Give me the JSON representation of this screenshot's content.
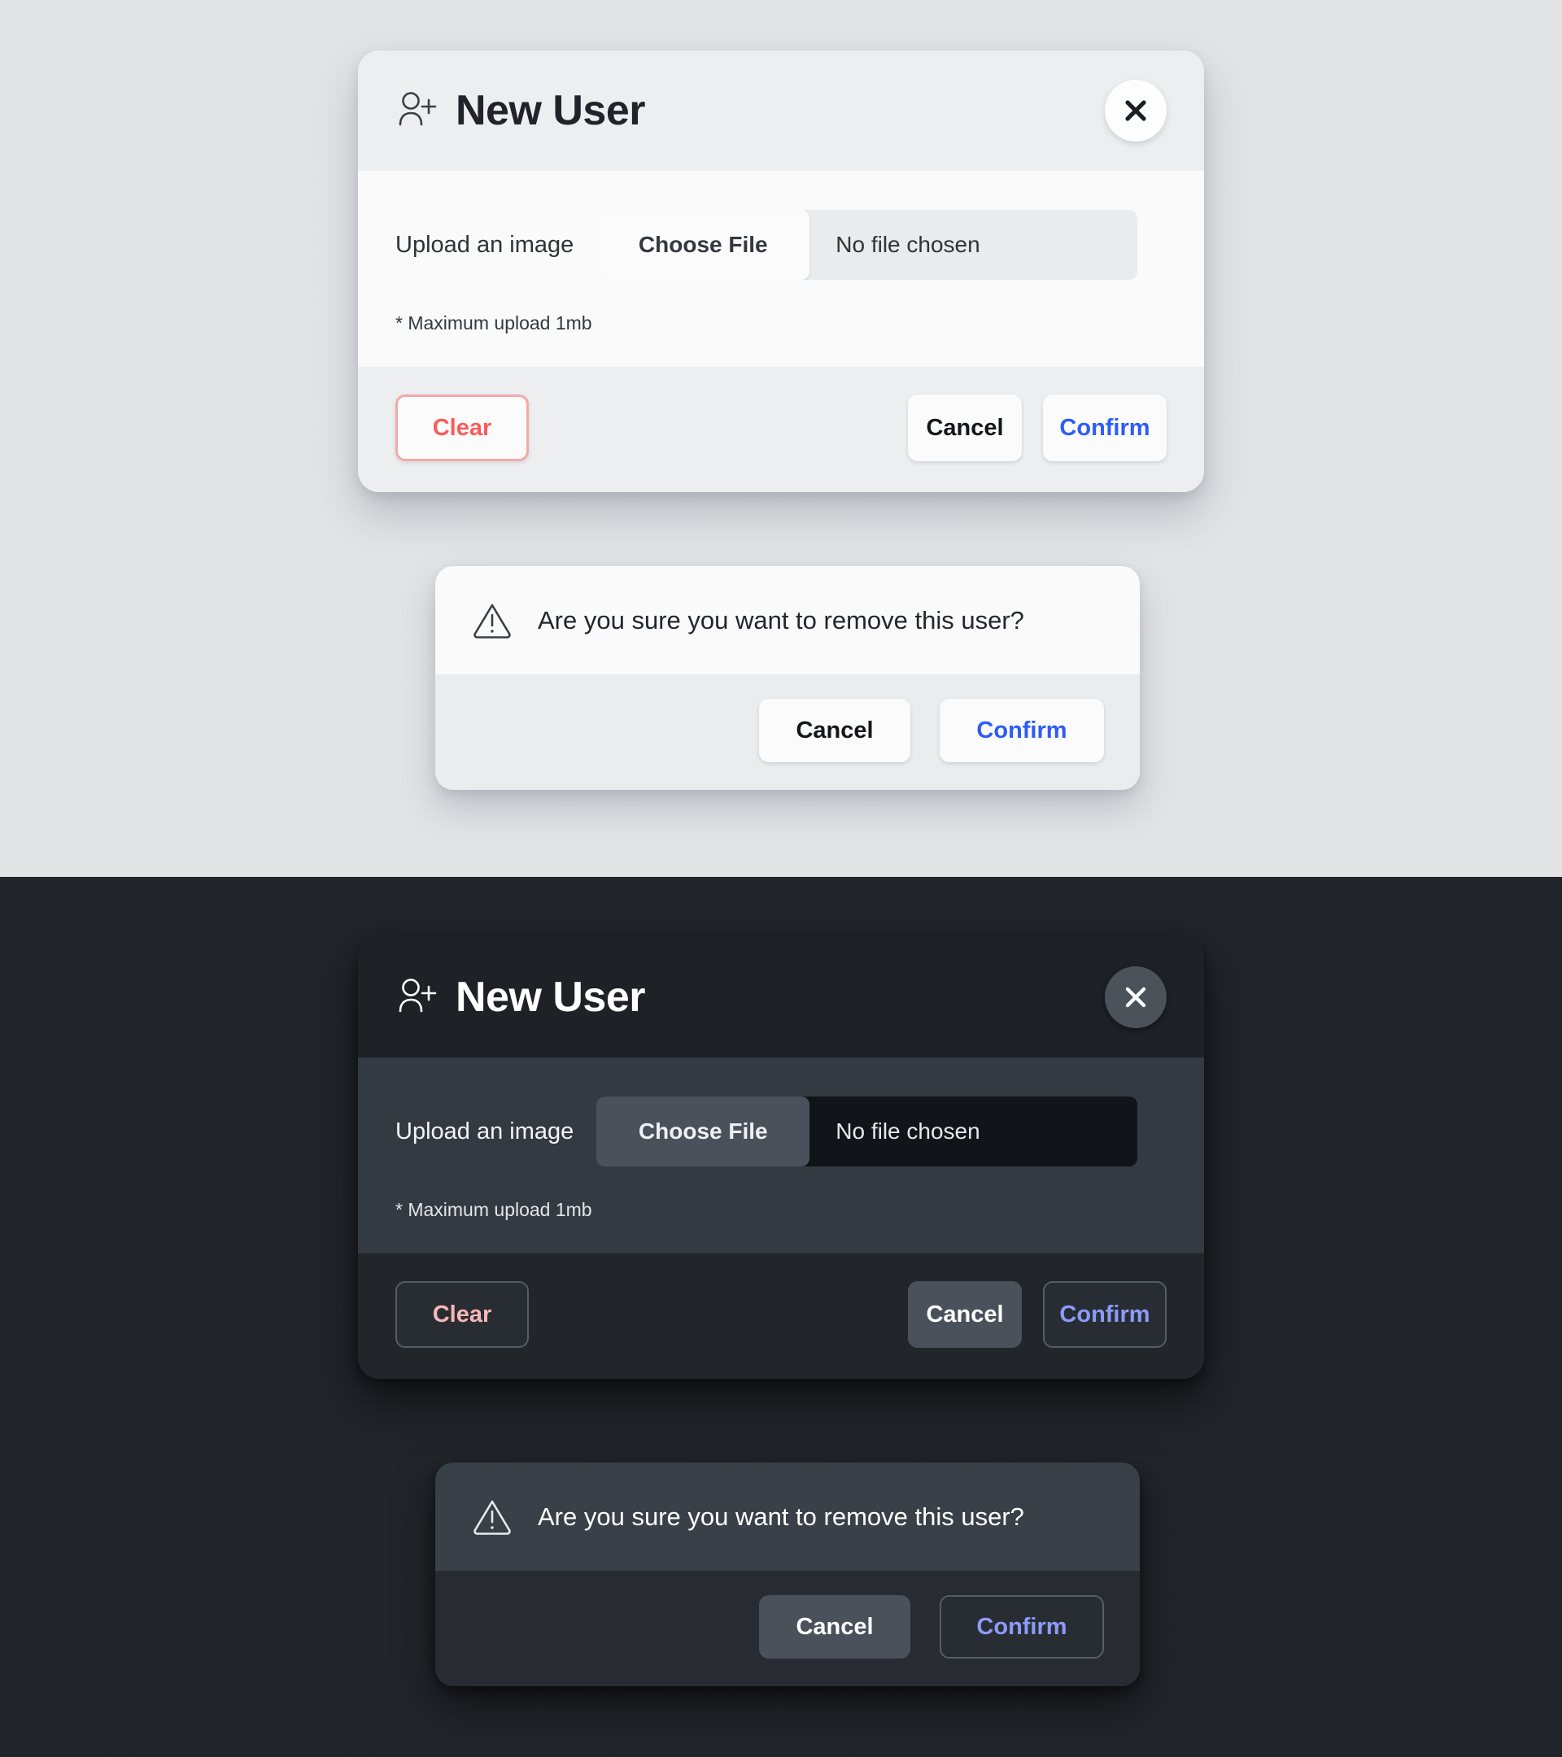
{
  "theme_panes": {
    "light_background": "#e1e3e5",
    "dark_background": "#212429"
  },
  "new_user_modal": {
    "title": "New User",
    "header_icon": "user-plus-icon",
    "close_icon": "close-icon",
    "upload": {
      "label": "Upload an image",
      "choose_file_label": "Choose File",
      "file_name_value": "No file chosen",
      "hint": "* Maximum upload 1mb"
    },
    "footer": {
      "clear_label": "Clear",
      "cancel_label": "Cancel",
      "confirm_label": "Confirm"
    },
    "colors": {
      "clear_text_light": "#fb5b5b",
      "clear_text_dark": "#f6b7b7",
      "confirm_text_light": "#2d5cf6",
      "confirm_text_dark": "#8c9bf8"
    }
  },
  "confirm_dialog": {
    "warning_icon": "warning-triangle-icon",
    "message": "Are you sure you want to remove this user?",
    "cancel_label": "Cancel",
    "confirm_label": "Confirm"
  }
}
